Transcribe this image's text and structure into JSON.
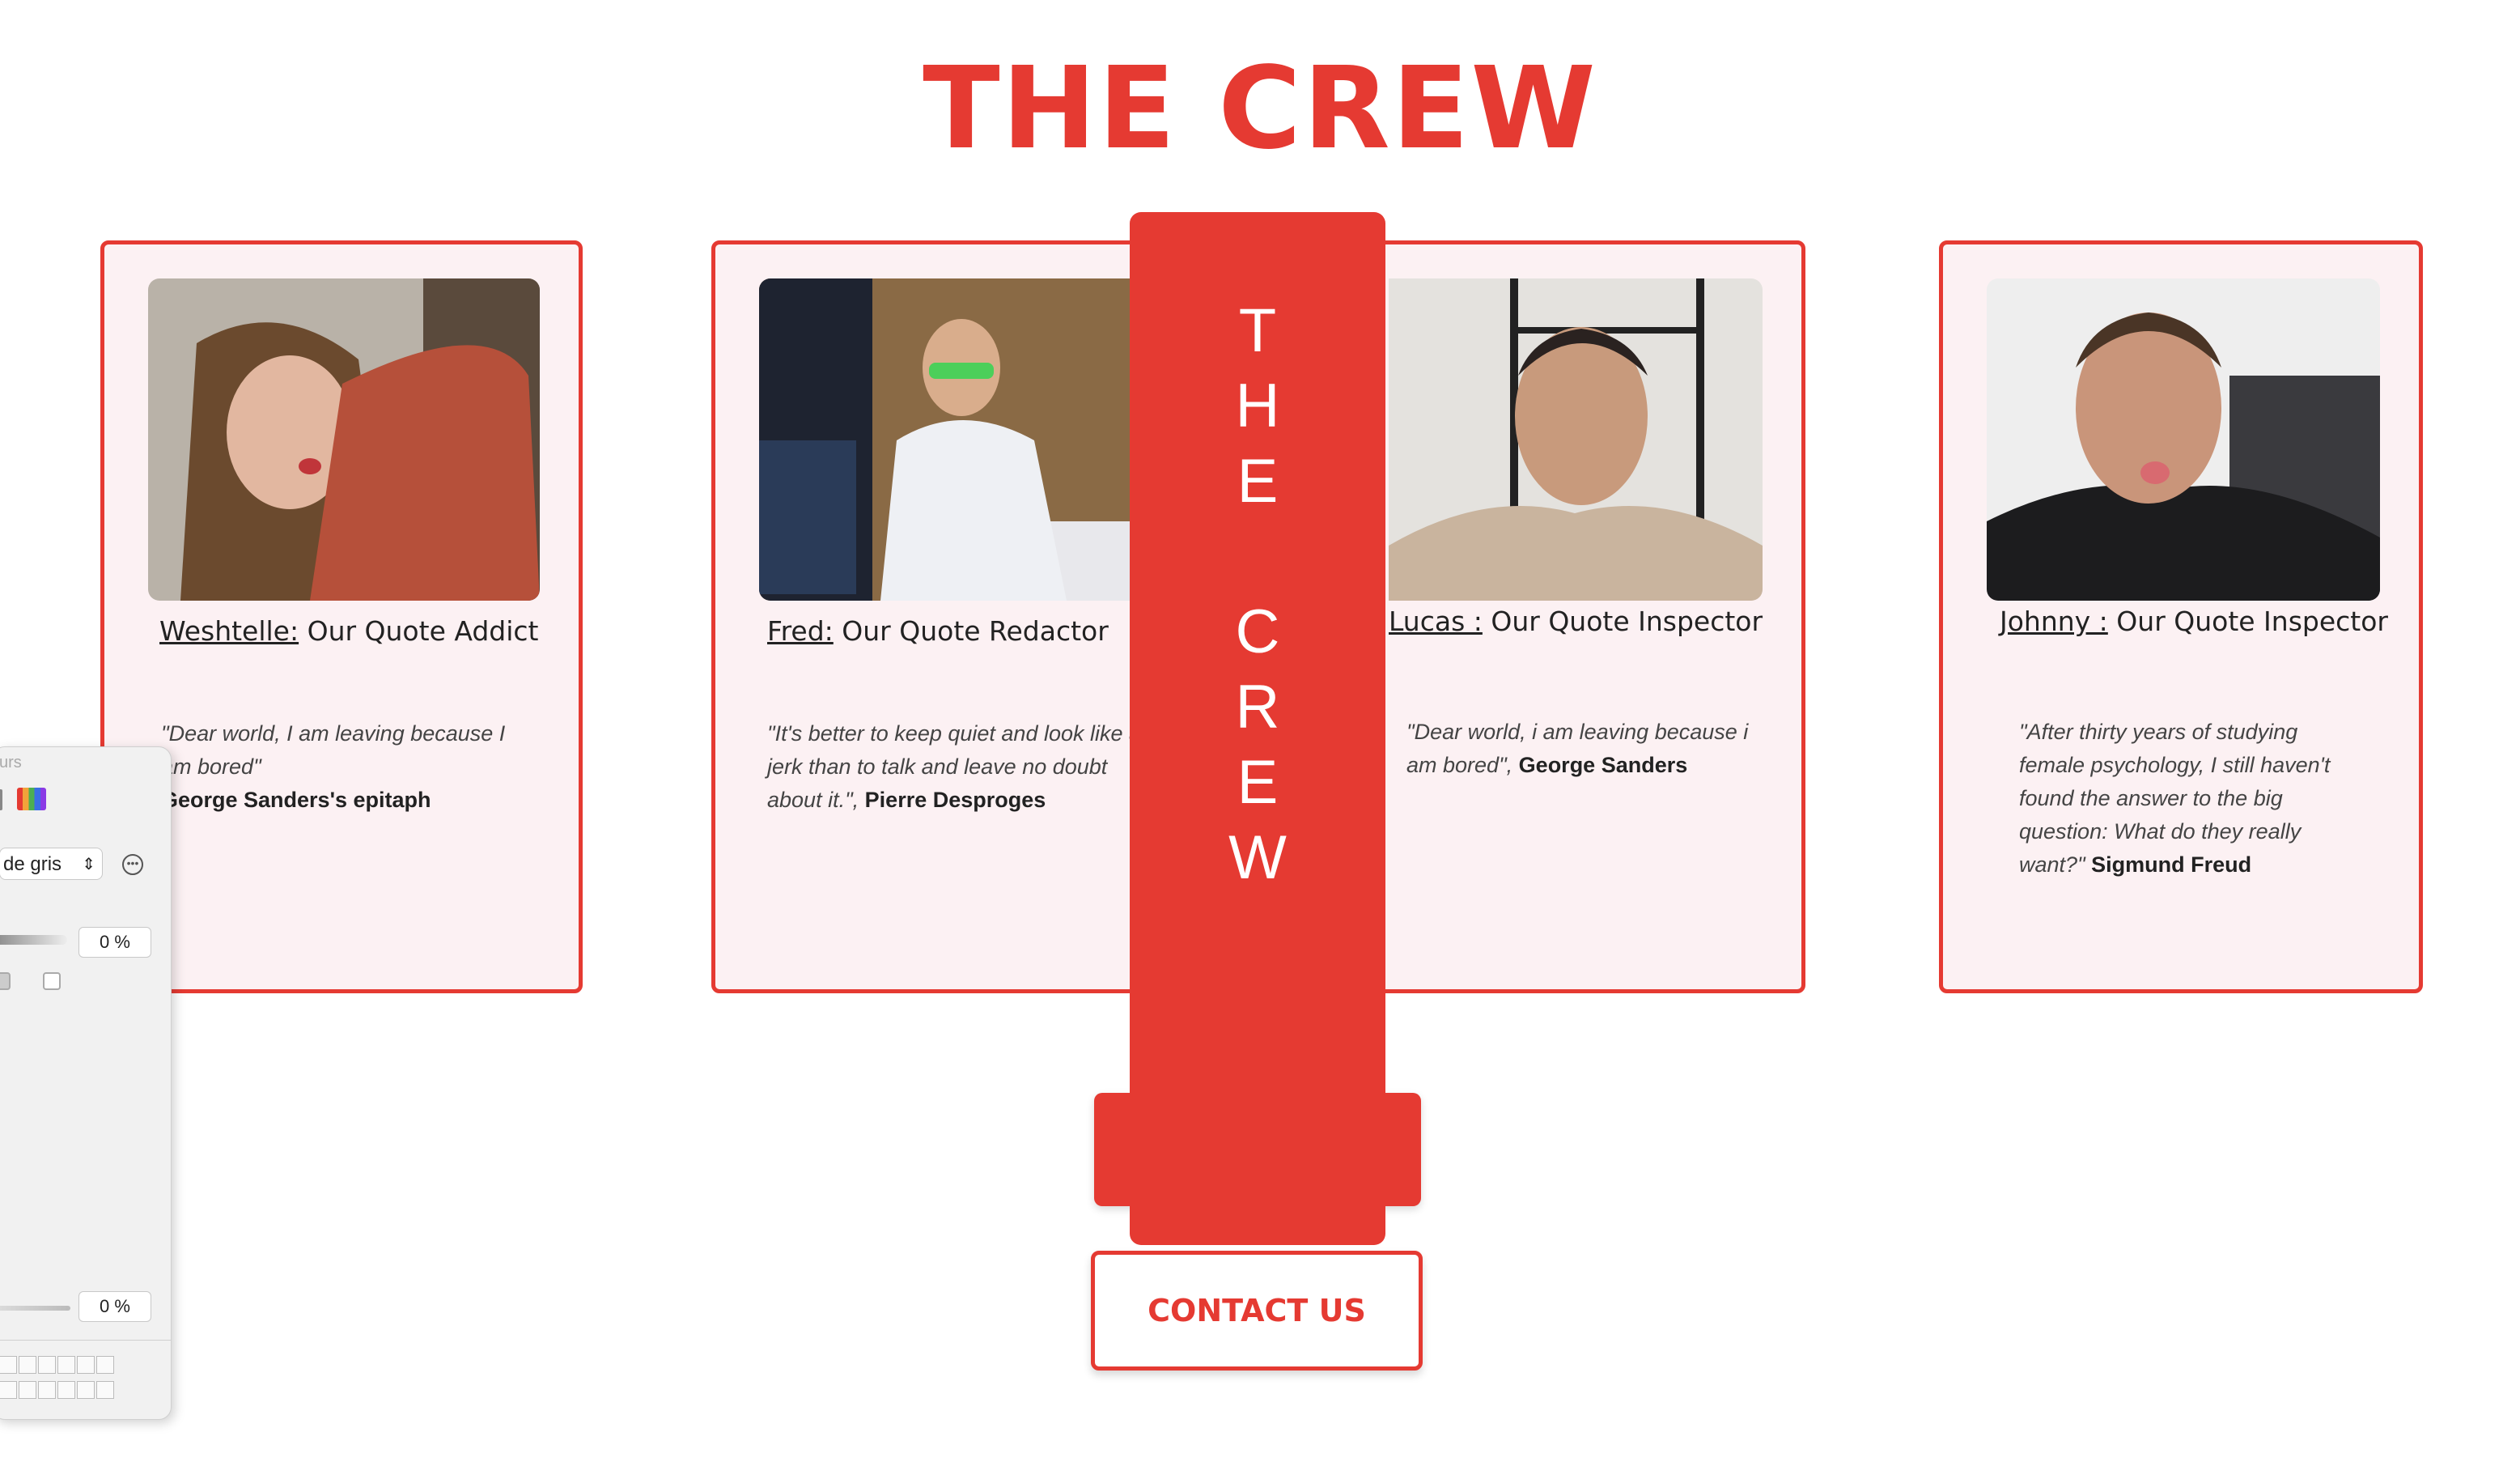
{
  "page": {
    "title": "THE CREW",
    "banner_letters": [
      "T",
      "H",
      "E",
      "",
      "C",
      "R",
      "E",
      "W"
    ],
    "contact_label": "CONTACT US",
    "hidden_button_label": ""
  },
  "crew": [
    {
      "name": "Weshtelle:",
      "role": " Our Quote Addict",
      "quote": "\"Dear world, I am leaving because I am bored\"",
      "author": "George Sanders's epitaph"
    },
    {
      "name": "Fred:",
      "role": " Our Quote Redactor",
      "quote": "\"It's better to keep quiet and look like a jerk than to talk and leave no doubt about it.\",",
      "author": "Pierre Desproges"
    },
    {
      "name": "Lucas :",
      "role": " Our Quote Inspector",
      "quote": "\"Dear world, i am leaving because i am bored\",",
      "author": "George Sanders"
    },
    {
      "name": "Johnny :",
      "role": " Our Quote Inspector",
      "quote": "\"After thirty years of studying female psychology, I still haven't found the answer to the big question: What do they really want?\"",
      "author": "Sigmund Freud"
    }
  ],
  "color_panel": {
    "header_label": "urs",
    "mode_select": "de gris",
    "slider_1_value": "0 %",
    "slider_2_value": "0 %"
  },
  "colors": {
    "accent": "#e53a32",
    "card_background": "#fcf1f3"
  }
}
